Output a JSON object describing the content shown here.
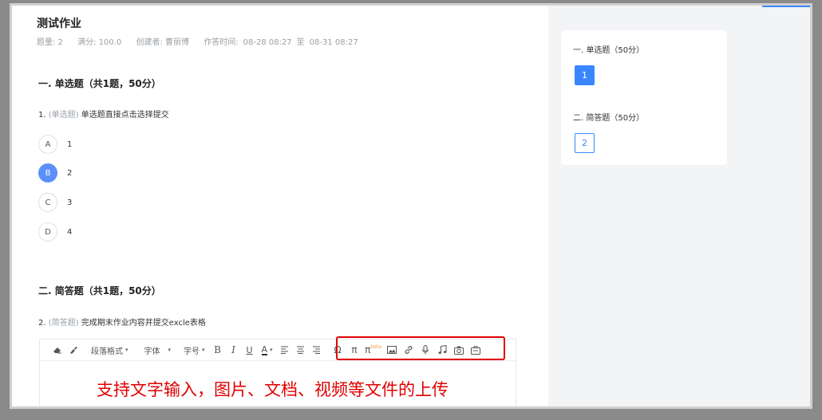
{
  "header": {
    "title": "测试作业",
    "meta": {
      "count": "题量: 2",
      "score": "满分: 100.0",
      "creator": "创建者: 曹丽博",
      "time_label": "作答时间:",
      "start": "08-28 08:27",
      "to": "至",
      "end": "08-31 08:27"
    }
  },
  "sections": [
    {
      "title": "一. 单选题（共1题，50分）",
      "question": {
        "number": "1.",
        "type": "(单选题)",
        "text": "单选题直接点击选择提交"
      },
      "options": [
        {
          "letter": "A",
          "text": "1",
          "selected": false
        },
        {
          "letter": "B",
          "text": "2",
          "selected": true
        },
        {
          "letter": "C",
          "text": "3",
          "selected": false
        },
        {
          "letter": "D",
          "text": "4",
          "selected": false
        }
      ]
    },
    {
      "title": "二. 简答题（共1题，50分）",
      "question": {
        "number": "2.",
        "type": "(简答题)",
        "text": "完成期末作业内容并提交excle表格"
      }
    }
  ],
  "toolbar": {
    "paragraph": "段落格式",
    "font": "字体",
    "font_size": "字号",
    "bold": "B",
    "italic": "I",
    "underline": "U",
    "font_color": "A",
    "omega": "Ω",
    "pi": "π",
    "pi_beta": "π",
    "beta_label": "beta",
    "caret": "▾"
  },
  "annotation": "支持文字输入，图片、文档、视频等文件的上传",
  "answer_card": {
    "section1": "一. 单选题（50分）",
    "section2": "二. 简答题（50分）",
    "num1": "1",
    "num2": "2"
  },
  "colors": {
    "accent": "#3a86ff",
    "selected_option": "#5b8ff9",
    "highlight": "#e00000",
    "sidebar_bg": "#f3f4f6"
  }
}
